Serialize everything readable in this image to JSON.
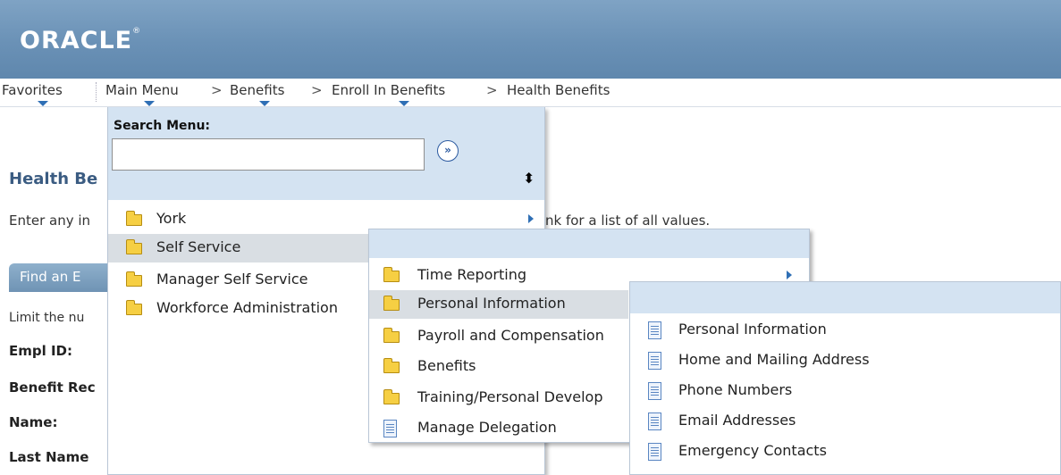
{
  "brand": {
    "logo": "ORACLE",
    "logo_mark": "®"
  },
  "navbar": {
    "favorites": "Favorites",
    "main_menu": "Main Menu",
    "sep": ">",
    "crumbs": [
      "Benefits",
      "Enroll In Benefits",
      "Health Benefits"
    ]
  },
  "page": {
    "title": "Health Be",
    "instruction_left": "Enter any in",
    "instruction_right": "nk for a list of all values.",
    "find_tab": "Find an E",
    "limit_text": "Limit the nu",
    "fields": [
      "Empl ID:",
      "Benefit Rec",
      "Name:",
      "Last Name"
    ]
  },
  "menu": {
    "search_label": "Search Menu:",
    "search_value": "",
    "go_glyph": "»",
    "sort_glyph": "⬍",
    "items": [
      "York",
      "Self Service",
      "Manager Self Service",
      "Workforce Administration"
    ],
    "selected": "Self Service"
  },
  "submenu": {
    "items": [
      "Time Reporting",
      "Personal Information",
      "Payroll and Compensation",
      "Benefits",
      "Training/Personal Develop",
      "Manage Delegation"
    ],
    "selected": "Personal Information"
  },
  "submenu2": {
    "items": [
      "Personal Information",
      "Home and Mailing Address",
      "Phone Numbers",
      "Email Addresses",
      "Emergency Contacts"
    ]
  },
  "colors": {
    "banner": "#6a91b6",
    "menu_header": "#d4e3f2",
    "title": "#3b5c82",
    "selected_row": "#d9dee3"
  }
}
